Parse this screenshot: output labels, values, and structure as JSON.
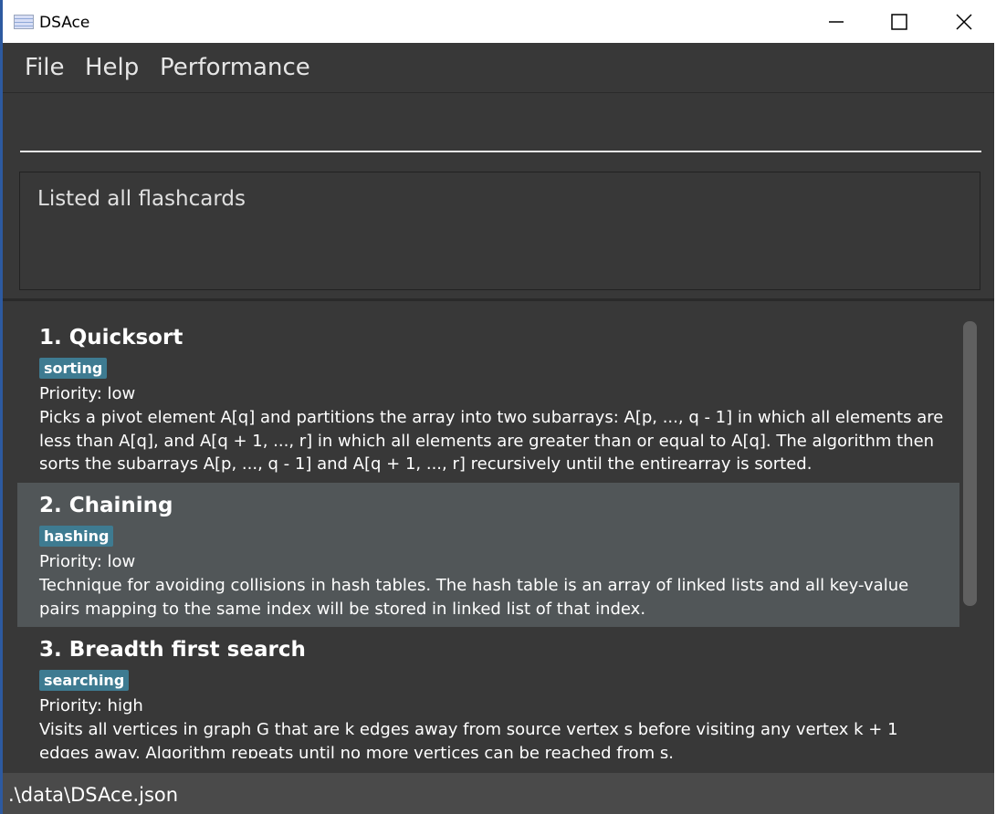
{
  "window": {
    "title": "DSAce"
  },
  "menubar": {
    "items": [
      "File",
      "Help",
      "Performance"
    ]
  },
  "command": {
    "value": "",
    "placeholder": ""
  },
  "result": {
    "message": "Listed all flashcards"
  },
  "flashcards": [
    {
      "title": "1.  Quicksort",
      "tag": "sorting",
      "priority": "Priority: low",
      "description": "Picks a pivot element A[q] and partitions the array into two subarrays: A[p, ..., q - 1] in which all elements are less than A[q], and A[q + 1, ..., r] in which all elements are greater than or equal to A[q]. The algorithm then sorts the subarrays A[p, ..., q - 1] and A[q + 1, ..., r] recursively until the entirearray is sorted."
    },
    {
      "title": "2.  Chaining",
      "tag": "hashing",
      "priority": "Priority: low",
      "description": "Technique for avoiding collisions in hash tables. The hash table is an array of linked lists and all key-value pairs mapping to the same index will be stored in linked list  of that index."
    },
    {
      "title": "3.  Breadth first search",
      "tag": "searching",
      "priority": "Priority: high",
      "description": "Visits all vertices in graph G that are k edges away from source vertex s before visiting any vertex k + 1 edges away. Algorithm repeats until no more vertices can be reached from s."
    }
  ],
  "statusbar": {
    "path": ".\\data\\DSAce.json"
  },
  "colors": {
    "background": "#383838",
    "card_dark": "#383838",
    "card_selected": "#515658",
    "tag": "#3e7b91"
  }
}
